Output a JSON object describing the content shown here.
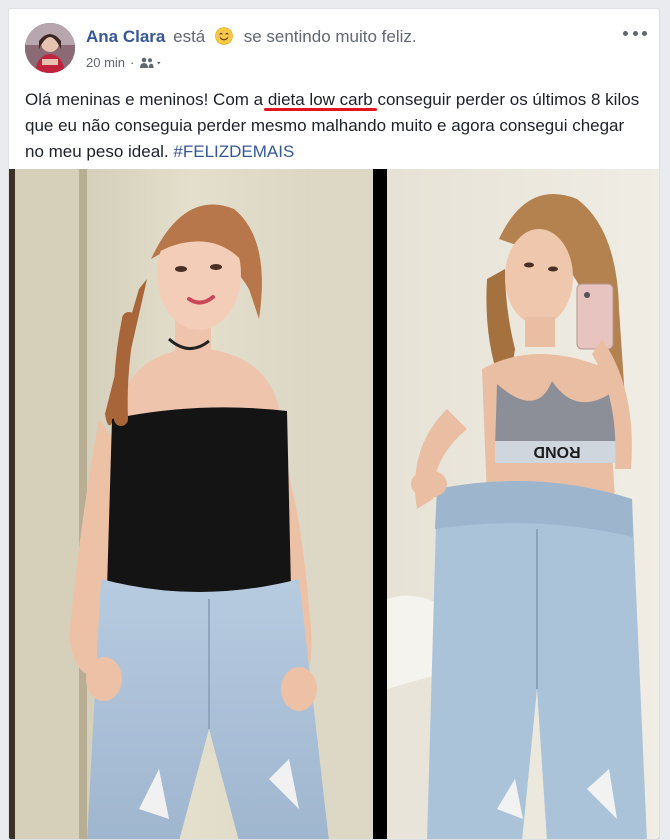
{
  "post": {
    "author": "Ana Clara",
    "feeling_verb": "está",
    "feeling": "se sentindo muito feliz.",
    "time": "20 min",
    "dot": "·",
    "body_before": "Olá meninas e meninos! Com a ",
    "body_highlight": "dieta low carb",
    "body_after": " conseguir perder os últimos 8 kilos que eu não conseguia perder mesmo malhando muito e agora consegui chegar no meu peso ideal. ",
    "hashtag": "#FELIZDEMAIS",
    "bra_print": "ROND"
  },
  "icons": {
    "emoji": "smiling-emoji-icon",
    "audience": "friends-audience-icon",
    "more": "more-options-icon"
  },
  "colors": {
    "author_link": "#365899",
    "underline": "#e0161c",
    "divider": "#000000"
  }
}
